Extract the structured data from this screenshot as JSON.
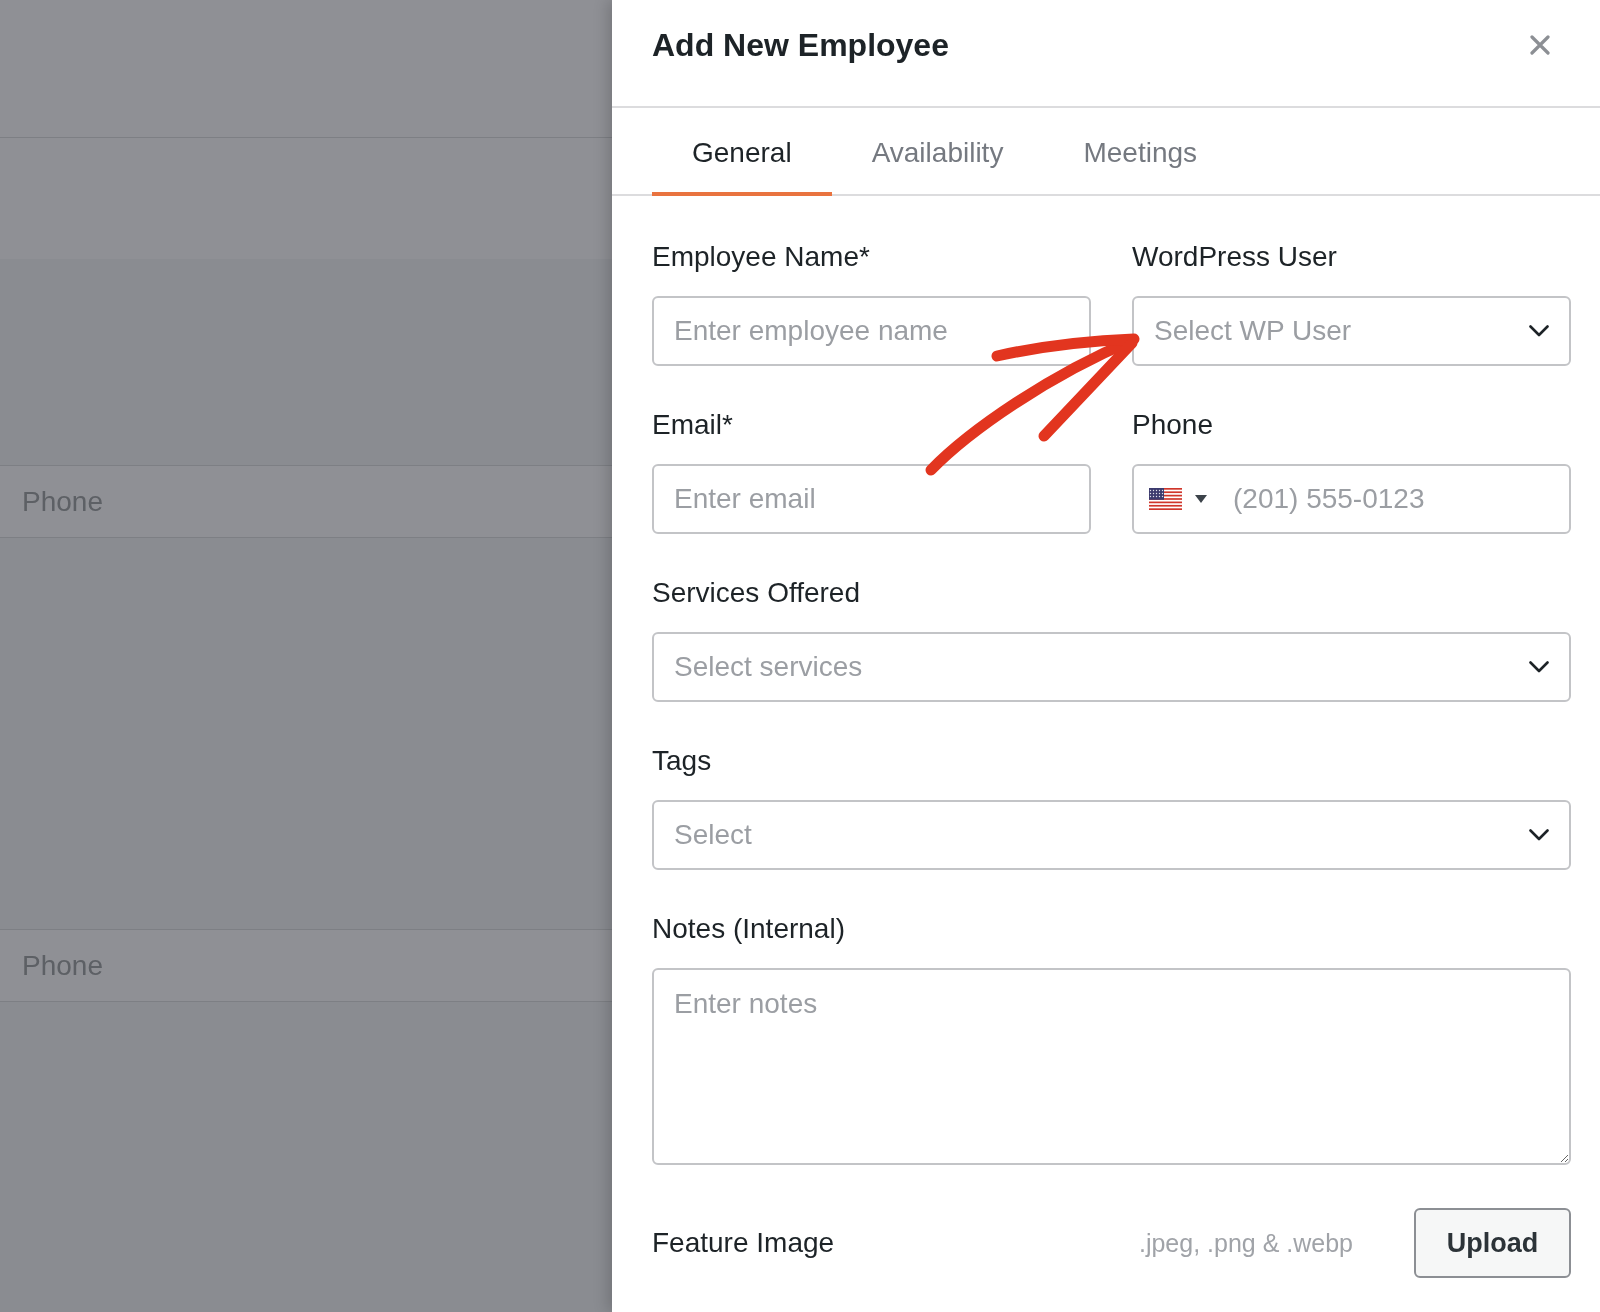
{
  "backdrop": {
    "row_labels": [
      "Phone",
      "Phone"
    ]
  },
  "title": "Add New Employee",
  "tabs": [
    {
      "label": "General",
      "selected": true
    },
    {
      "label": "Availability",
      "selected": false
    },
    {
      "label": "Meetings",
      "selected": false
    }
  ],
  "form": {
    "rows": [
      {
        "fields": [
          {
            "kind": "text",
            "label": "Employee Name*",
            "placeholder": "Enter employee name"
          },
          {
            "kind": "select",
            "label": "WordPress User",
            "placeholder": "Select WP User"
          }
        ]
      },
      {
        "fields": [
          {
            "kind": "text",
            "label": "Email*",
            "placeholder": "Enter email"
          },
          {
            "kind": "phone",
            "label": "Phone",
            "placeholder": "(201) 555-0123"
          }
        ]
      },
      {
        "fields": [
          {
            "kind": "select",
            "label": "Services Offered",
            "placeholder": "Select services"
          }
        ]
      },
      {
        "fields": [
          {
            "kind": "select",
            "label": "Tags",
            "placeholder": "Select"
          }
        ]
      },
      {
        "fields": [
          {
            "kind": "textarea",
            "label": "Notes (Internal)",
            "placeholder": "Enter notes"
          }
        ]
      }
    ]
  },
  "feature_image": {
    "label": "Feature Image",
    "hint": ".jpeg, .png & .webp",
    "button": "Upload"
  }
}
